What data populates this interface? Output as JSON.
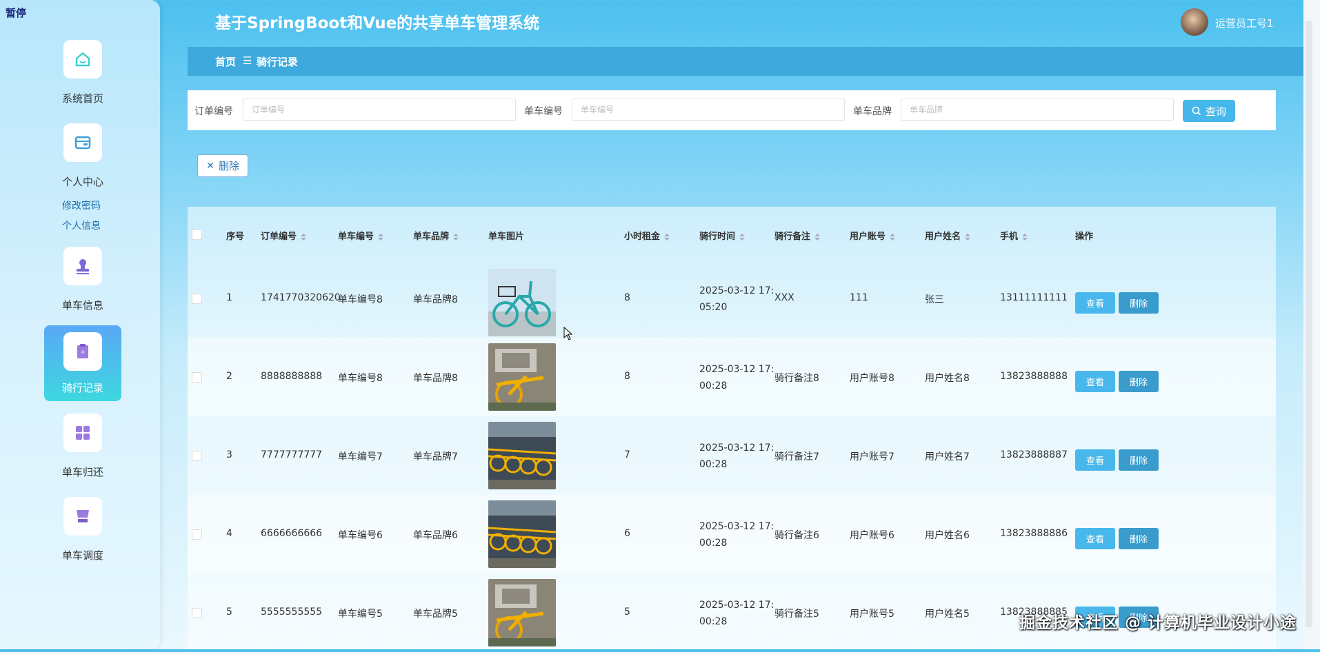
{
  "pause_label": "暂停",
  "app": {
    "title": "基于SpringBoot和Vue的共享单车管理系统",
    "user": "运营员工号1"
  },
  "sidebar": {
    "items": [
      {
        "label": "系统首页",
        "icon": "home-icon"
      },
      {
        "label": "个人中心",
        "icon": "wallet-icon"
      },
      {
        "label": "单车信息",
        "icon": "stamp-icon"
      },
      {
        "label": "骑行记录",
        "icon": "clipboard-icon"
      },
      {
        "label": "单车归还",
        "icon": "grid-icon"
      },
      {
        "label": "单车调度",
        "icon": "dispatch-icon"
      }
    ],
    "sub_items": [
      "修改密码",
      "个人信息"
    ]
  },
  "breadcrumb": {
    "home": "首页",
    "separator": "☰",
    "current": "骑行记录"
  },
  "search": {
    "fields": [
      {
        "label": "订单编号",
        "placeholder": "订单编号"
      },
      {
        "label": "单车编号",
        "placeholder": "单车编号"
      },
      {
        "label": "单车品牌",
        "placeholder": "单车品牌"
      }
    ],
    "button": "查询"
  },
  "toolbar": {
    "delete": "删除"
  },
  "table": {
    "headers": [
      "序号",
      "订单编号",
      "单车编号",
      "单车品牌",
      "单车图片",
      "小时租金",
      "骑行时间",
      "骑行备注",
      "用户账号",
      "用户姓名",
      "手机",
      "操作"
    ],
    "rows": [
      {
        "no": "1",
        "order": "1741770320620",
        "bike_no": "单车编号8",
        "brand": "单车品牌8",
        "img": "teal-bike",
        "rent": "8",
        "time1": "2025-03-12 17:",
        "time2": "05:20",
        "note": "XXX",
        "account": "111",
        "name": "张三",
        "phone": "13111111111"
      },
      {
        "no": "2",
        "order": "8888888888",
        "bike_no": "单车编号8",
        "brand": "单车品牌8",
        "img": "yellow-bike",
        "rent": "8",
        "time1": "2025-03-12 17:",
        "time2": "00:28",
        "note": "骑行备注8",
        "account": "用户账号8",
        "name": "用户姓名8",
        "phone": "13823888888"
      },
      {
        "no": "3",
        "order": "7777777777",
        "bike_no": "单车编号7",
        "brand": "单车品牌7",
        "img": "bike-row",
        "rent": "7",
        "time1": "2025-03-12 17:",
        "time2": "00:28",
        "note": "骑行备注7",
        "account": "用户账号7",
        "name": "用户姓名7",
        "phone": "13823888887"
      },
      {
        "no": "4",
        "order": "6666666666",
        "bike_no": "单车编号6",
        "brand": "单车品牌6",
        "img": "bike-row",
        "rent": "6",
        "time1": "2025-03-12 17:",
        "time2": "00:28",
        "note": "骑行备注6",
        "account": "用户账号6",
        "name": "用户姓名6",
        "phone": "13823888886"
      },
      {
        "no": "5",
        "order": "5555555555",
        "bike_no": "单车编号5",
        "brand": "单车品牌5",
        "img": "yellow-bike",
        "rent": "5",
        "time1": "2025-03-12 17:",
        "time2": "00:28",
        "note": "骑行备注5",
        "account": "用户账号5",
        "name": "用户姓名5",
        "phone": "13823888885"
      }
    ],
    "view_label": "查看",
    "delete_label": "删除"
  },
  "watermark": "掘金技术社区 @ 计算机毕业设计小途"
}
